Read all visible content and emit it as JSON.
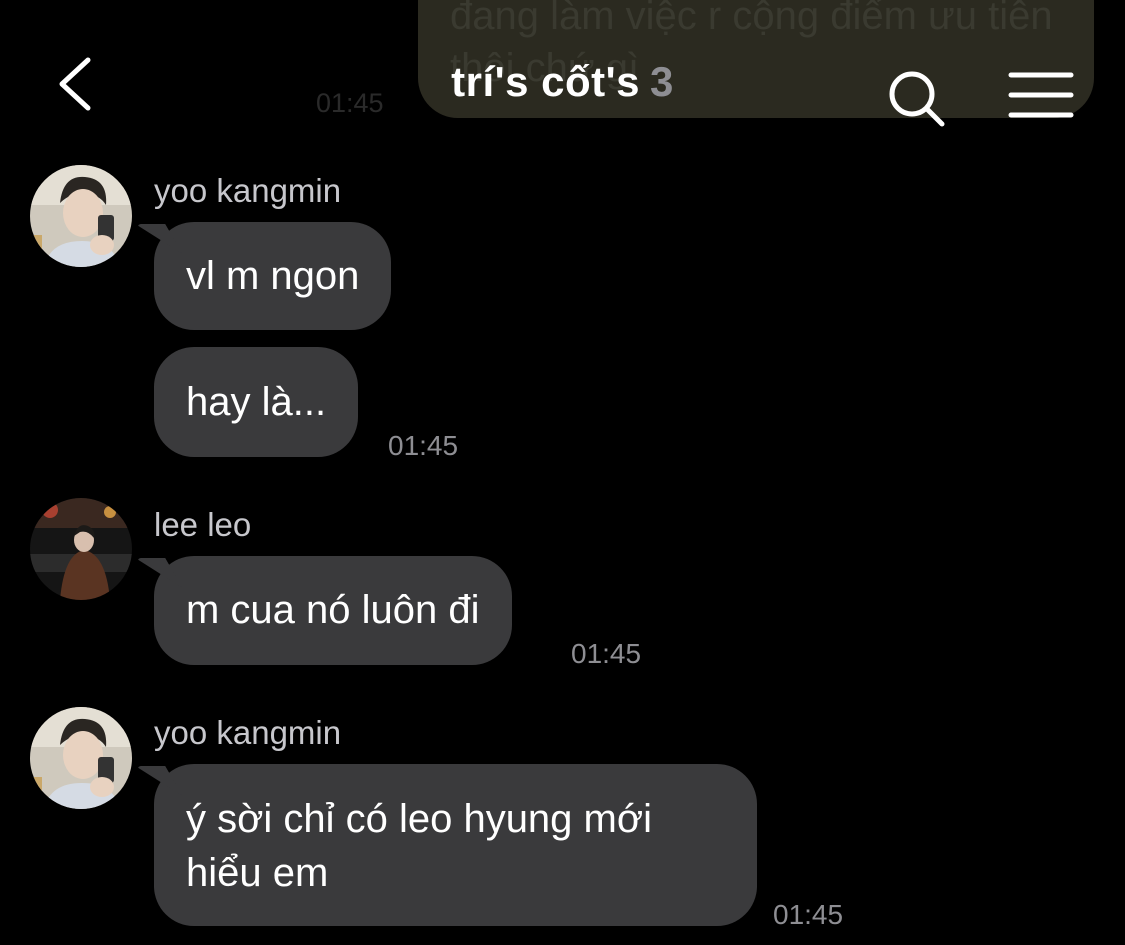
{
  "header": {
    "title": "trí's cốt's",
    "member_count": "3",
    "back_icon": "chevron-left-icon",
    "search_icon": "search-icon",
    "menu_icon": "menu-icon"
  },
  "previous_message": {
    "text": "đang làm việc r cộng điểm ưu tiên thôi chứ gì",
    "time": "01:45"
  },
  "messages": [
    {
      "sender": "yoo kangmin",
      "bubbles": [
        "vl m ngon",
        "hay là..."
      ],
      "time": "01:45"
    },
    {
      "sender": "lee leo",
      "bubbles": [
        "m cua nó luôn đi"
      ],
      "time": "01:45"
    },
    {
      "sender": "yoo kangmin",
      "bubbles": [
        "ý sời chỉ có leo hyung mới hiểu em"
      ],
      "time": "01:45"
    }
  ],
  "colors": {
    "background": "#000000",
    "bubble": "#3a3a3c",
    "secondary_text": "#8e8e93"
  }
}
